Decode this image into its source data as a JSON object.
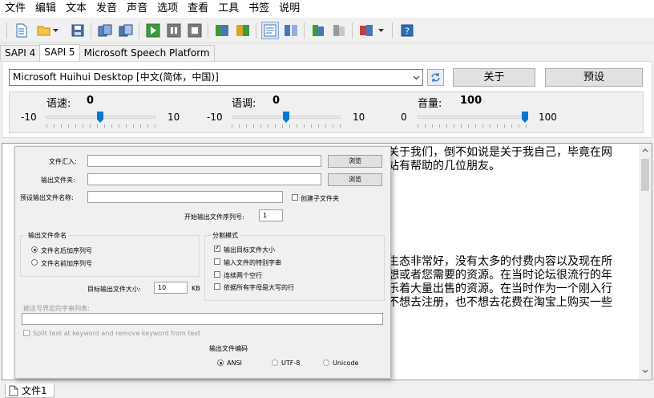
{
  "menu": [
    "文件",
    "编辑",
    "文本",
    "发音",
    "声音",
    "选项",
    "查看",
    "工具",
    "书签",
    "说明"
  ],
  "tabs": [
    "SAPI 4",
    "SAPI 5",
    "Microsoft Speech Platform"
  ],
  "active_tab": "SAPI 5",
  "voice": {
    "selected": "Microsoft Huihui Desktop [中文(简体，中国)]"
  },
  "buttons": {
    "about": "关于",
    "preset": "预设"
  },
  "sliders": {
    "rate": {
      "label": "语速:",
      "value": "0",
      "min": "-10",
      "max": "10",
      "level": 0.5
    },
    "pitch": {
      "label": "语调:",
      "value": "0",
      "min": "-10",
      "max": "10",
      "level": 0.5
    },
    "volume": {
      "label": "音量:",
      "value": "100",
      "min": "0",
      "max": "100",
      "level": 1.0
    }
  },
  "text_lines": [
    "关于我们，倒不如说是关于我自己，毕竟在网",
    "站有帮助的几位朋友。",
    "生态非常好，没有太多的付费内容以及现在所",
    "想或者您需要的资源。在当时论坛很流行的年",
    "乐着大量出售的资源。在当时作为一个刚入行",
    "不想去注册，也不想去花费在淘宝上购买一些"
  ],
  "dialog": {
    "import_file_label": "文件汇入:",
    "output_folder_label": "输出文件夹:",
    "browse_label": "浏览",
    "default_name_label": "预设输出文件名称:",
    "create_subfolder_label": "创建子文件夹",
    "start_seq_label": "开始输出文件序列号:",
    "start_seq_value": "1",
    "naming_group_title": "输出文件命名",
    "naming_options": [
      "文件名后加序列号",
      "文件名前加序列号"
    ],
    "naming_selected": 0,
    "split_group_title": "分割模式",
    "split_options": [
      {
        "label": "输出目标文件大小",
        "checked": true
      },
      {
        "label": "输入文件的特别字串",
        "checked": false
      },
      {
        "label": "连续两个空行",
        "checked": false
      },
      {
        "label": "依据所有字母是大写的行",
        "checked": false
      }
    ],
    "target_size_label": "目标输出文件大小:",
    "target_size_value": "10",
    "target_size_unit": "KB",
    "keyword_label": "被这号界定的字串列表:",
    "split_keyword_label": "Split text at keyword and remove keyword from text",
    "encoding_group_title": "输出文件编码",
    "encodings": [
      "ANSI",
      "UTF-8",
      "Unicode"
    ],
    "encoding_selected": 0
  },
  "file_tab": "文件1"
}
